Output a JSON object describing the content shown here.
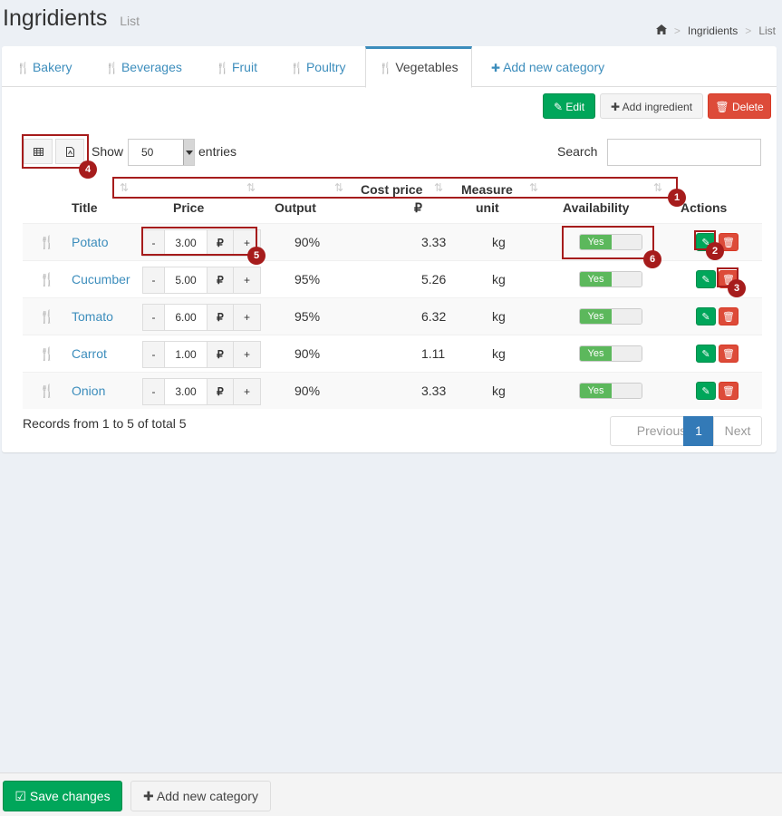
{
  "header": {
    "title": "Ingridients",
    "subtitle": "List"
  },
  "breadcrumb": {
    "home_icon": "home-icon",
    "sep": ">",
    "items": [
      "Ingridients",
      "List"
    ]
  },
  "tabs": [
    {
      "label": "Bakery",
      "icon": "cutlery-icon"
    },
    {
      "label": "Beverages",
      "icon": "cutlery-icon"
    },
    {
      "label": "Fruit",
      "icon": "cutlery-icon"
    },
    {
      "label": "Poultry",
      "icon": "cutlery-icon"
    },
    {
      "label": "Vegetables",
      "icon": "cutlery-icon",
      "active": true
    },
    {
      "label": "Add new category",
      "icon": "plus-icon"
    }
  ],
  "toolbar": {
    "edit": "Edit",
    "add": "Add ingredient",
    "delete": "Delete"
  },
  "table_controls": {
    "show": "Show",
    "entries_value": "50",
    "entries": "entries",
    "search": "Search"
  },
  "columns": {
    "title": "Title",
    "price": "Price",
    "output": "Output",
    "cost": "Cost price",
    "cost_unit": "₽",
    "measure": "Measure",
    "measure_unit": "unit",
    "availability": "Availability",
    "actions": "Actions"
  },
  "currency": "₽",
  "rows": [
    {
      "title": "Potato",
      "price": "3.00",
      "output": "90%",
      "cost": "3.33",
      "unit": "kg",
      "available": "Yes"
    },
    {
      "title": "Cucumber",
      "price": "5.00",
      "output": "95%",
      "cost": "5.26",
      "unit": "kg",
      "available": "Yes"
    },
    {
      "title": "Tomato",
      "price": "6.00",
      "output": "95%",
      "cost": "6.32",
      "unit": "kg",
      "available": "Yes"
    },
    {
      "title": "Carrot",
      "price": "1.00",
      "output": "90%",
      "cost": "1.11",
      "unit": "kg",
      "available": "Yes"
    },
    {
      "title": "Onion",
      "price": "3.00",
      "output": "90%",
      "cost": "3.33",
      "unit": "kg",
      "available": "Yes"
    }
  ],
  "footer": {
    "records": "Records from 1 to 5 of total 5",
    "prev": "Previous",
    "page": "1",
    "next": "Next"
  },
  "bottom": {
    "save": "Save changes",
    "add_category": "Add new category"
  },
  "annotations": [
    "1",
    "2",
    "3",
    "4",
    "5",
    "6"
  ],
  "colors": {
    "primary": "#3c8dbc",
    "success": "#00a65a",
    "danger": "#dd4b39",
    "annotation": "#a61c1c"
  }
}
